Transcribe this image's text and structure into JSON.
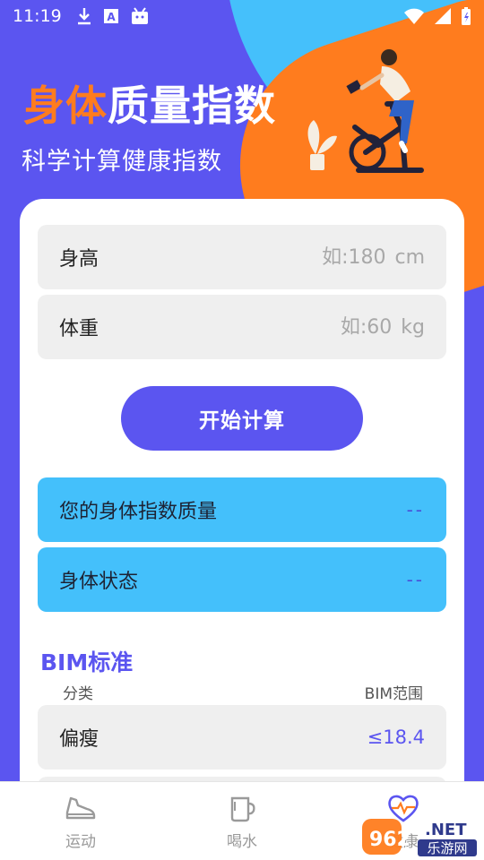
{
  "status_bar": {
    "time": "11:19",
    "icons": [
      "download-icon",
      "a-icon",
      "android-icon"
    ],
    "right_icons": [
      "wifi-icon",
      "signal-icon",
      "battery-icon"
    ]
  },
  "header": {
    "title_accent": "身体",
    "title_rest": "质量指数",
    "subtitle": "科学计算健康指数"
  },
  "form": {
    "height": {
      "label": "身高",
      "placeholder": "如:180",
      "unit": "cm"
    },
    "weight": {
      "label": "体重",
      "placeholder": "如:60",
      "unit": "kg"
    },
    "submit_label": "开始计算"
  },
  "results": {
    "index": {
      "label": "您的身体指数质量",
      "value": "--"
    },
    "status": {
      "label": "身体状态",
      "value": "--"
    }
  },
  "standard": {
    "title": "BIM标准",
    "col_category": "分类",
    "col_range": "BIM范围",
    "rows": [
      {
        "category": "偏瘦",
        "range": "≤18.4"
      }
    ]
  },
  "tabs": [
    {
      "label": "运动",
      "icon": "shoe-icon"
    },
    {
      "label": "喝水",
      "icon": "cup-icon"
    },
    {
      "label": "健康",
      "icon": "heart-icon"
    }
  ],
  "watermark": {
    "number": "962",
    "suffix": ".NET",
    "site": "乐游网"
  },
  "colors": {
    "primary": "#5b55f0",
    "orange": "#ff7c1e",
    "blue": "#45c0fb"
  }
}
